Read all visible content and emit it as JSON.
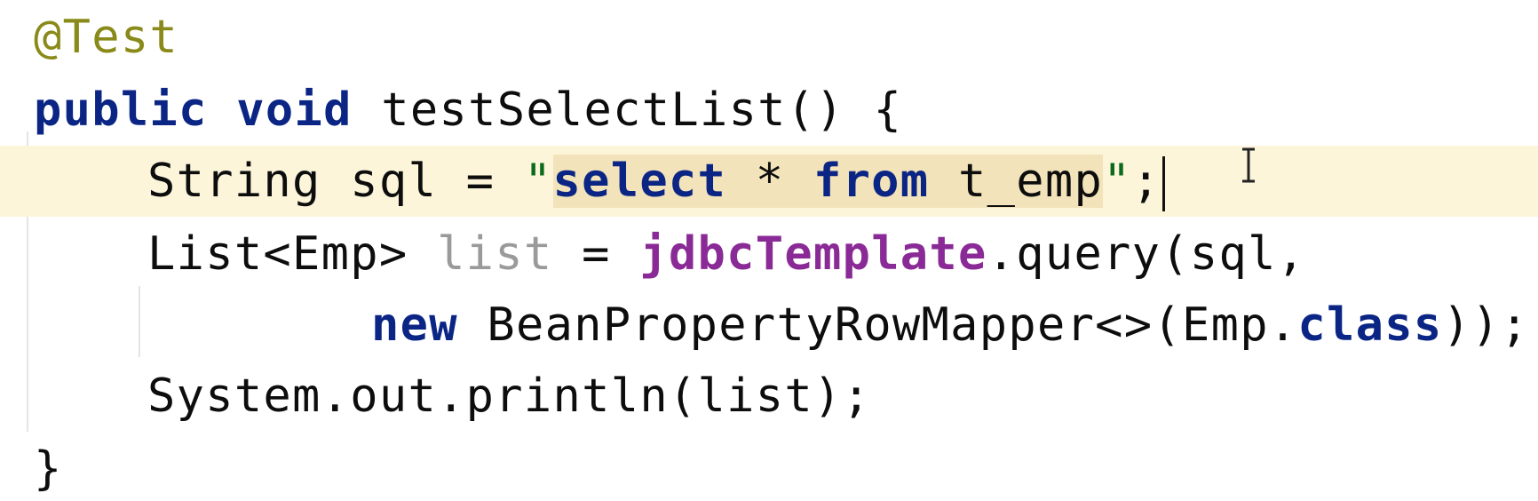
{
  "code": {
    "annotation": "@Test",
    "line2": {
      "kw_public": "public",
      "kw_void": "void",
      "method_sig": "testSelectList() {"
    },
    "line3": {
      "type_decl": "String sql = ",
      "quote_open": "\"",
      "sql_select": "select",
      "sql_star": " * ",
      "sql_from": "from",
      "sql_table": " t_emp",
      "quote_close": "\"",
      "semicolon": ";"
    },
    "line4": {
      "type_decl": "List<Emp> ",
      "var_list": "list",
      "assign": " = ",
      "field_name": "jdbcTemplate",
      "call": ".query(sql,"
    },
    "line5": {
      "kw_new": "new",
      "ctor": " BeanPropertyRowMapper<>(Emp.",
      "kw_class": "class",
      "tail": "));"
    },
    "line6": "System.out.println(list);",
    "line7": "}"
  },
  "colors": {
    "keyword": "#0b2585",
    "annotation": "#8a8a1a",
    "field": "#8a2a96",
    "unused_variable": "#9a9a9a",
    "current_line_bg": "#fcf5da",
    "sql_highlight_bg": "#f2e3ba"
  },
  "icons": {
    "mouse_cursor": "i-beam-cursor-icon"
  }
}
